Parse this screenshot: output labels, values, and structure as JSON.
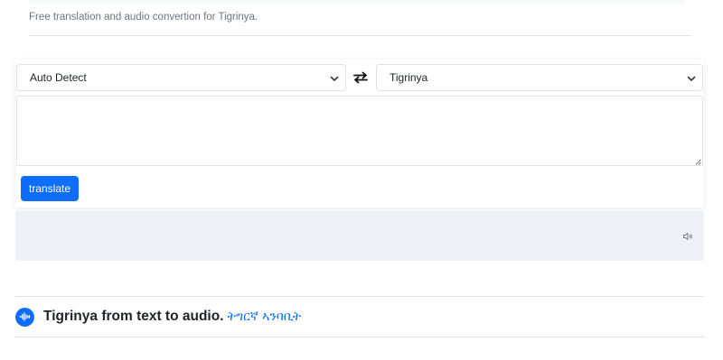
{
  "header": {
    "tagline": "Free translation and audio convertion for Tigrinya."
  },
  "translator": {
    "source_language": "Auto Detect",
    "target_language": "Tigrinya",
    "input_value": "",
    "translate_label": "translate",
    "output_text": ""
  },
  "section": {
    "title": "Tigrinya from text to audio.",
    "link": "ትግርኛ ኣንባቢት"
  },
  "icons": {
    "swap": "swap-arrows-icon",
    "speaker": "speaker-icon",
    "audio": "audio-wave-icon",
    "chevron": "chevron-down-icon"
  },
  "colors": {
    "accent": "#0d6efd",
    "output_bg": "#eef1f8",
    "muted_text": "#6c757d"
  }
}
